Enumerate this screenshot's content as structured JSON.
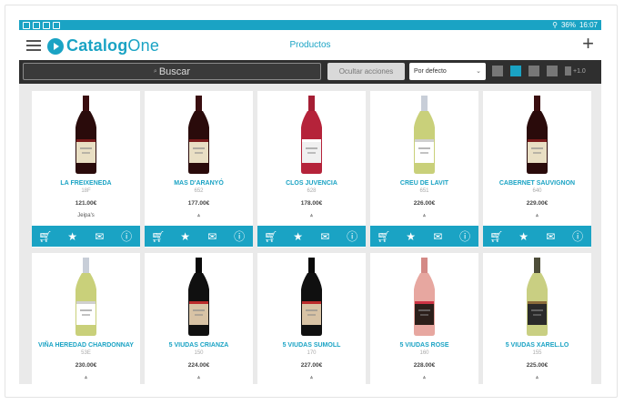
{
  "statusbar": {
    "battery": "36%",
    "time": "16:07"
  },
  "app": {
    "logo_bold": "Catalog",
    "logo_light": "One",
    "title": "Productos"
  },
  "toolbar": {
    "search_placeholder": "Buscar",
    "hide_actions": "Ocultar acciones",
    "sort": "Por defecto",
    "zoom": "+1.0"
  },
  "colors": {
    "accent": "#1aa3c4",
    "toolbar": "#2f2f2f"
  },
  "products": [
    {
      "name": "LA FREIXENEDA",
      "code": "18F",
      "price": "121.00€",
      "brand": "Jeipa's",
      "bottle": "red"
    },
    {
      "name": "MAS D'ARANYÓ",
      "code": "652",
      "price": "177.00€",
      "brand": "",
      "bottle": "red"
    },
    {
      "name": "CLOS JUVENCIA",
      "code": "628",
      "price": "178.00€",
      "brand": "",
      "bottle": "rose"
    },
    {
      "name": "CREU DE LAVIT",
      "code": "651",
      "price": "226.00€",
      "brand": "",
      "bottle": "white"
    },
    {
      "name": "CABERNET SAUVIGNON",
      "code": "640",
      "price": "229.00€",
      "brand": "",
      "bottle": "red"
    },
    {
      "name": "VIÑA HEREDAD CHARDONNAY",
      "code": "53E",
      "price": "230.00€",
      "brand": "",
      "bottle": "white"
    },
    {
      "name": "5 VIUDAS CRIANZA",
      "code": "150",
      "price": "224.00€",
      "brand": "",
      "bottle": "dark"
    },
    {
      "name": "5 VIUDAS SUMOLL",
      "code": "170",
      "price": "227.00€",
      "brand": "",
      "bottle": "dark"
    },
    {
      "name": "5 VIUDAS ROSE",
      "code": "160",
      "price": "228.00€",
      "brand": "",
      "bottle": "rosebottle"
    },
    {
      "name": "5 VIUDAS XAREL.LO",
      "code": "155",
      "price": "225.00€",
      "brand": "",
      "bottle": "white2"
    }
  ],
  "action_icons": [
    "cart-icon",
    "star-icon",
    "email-icon",
    "info-icon"
  ]
}
